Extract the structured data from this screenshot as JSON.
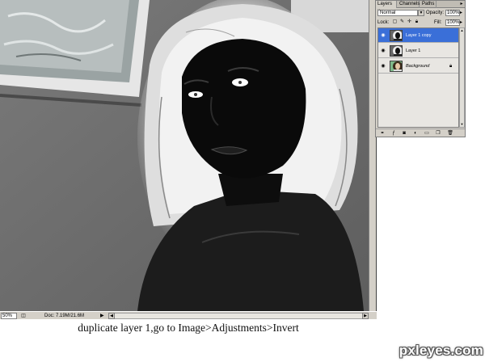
{
  "layers_panel": {
    "tabs": [
      {
        "label": "Layers ×"
      },
      {
        "label": "Channels"
      },
      {
        "label": "Paths"
      }
    ],
    "menu_icon": "panel-menu-arrow-icon",
    "blend_mode": "Normal",
    "opacity_label": "Opacity:",
    "opacity_value": "100%",
    "lock_label": "Lock:",
    "fill_label": "Fill:",
    "fill_value": "100%",
    "layers": [
      {
        "name": "Layer 1 copy",
        "selected": true,
        "thumb": "inverted-portrait"
      },
      {
        "name": "Layer 1",
        "selected": false,
        "thumb": "inverted-portrait"
      },
      {
        "name": "Background",
        "selected": false,
        "thumb": "color-portrait",
        "locked": true
      }
    ],
    "colors": {
      "selection": "#3a6fd8",
      "panel_bg": "#d4d0c8"
    }
  },
  "status_bar": {
    "zoom": "50%",
    "doc_size": "Doc: 7.19M/21.6M"
  },
  "caption": "duplicate layer 1,go to Image>Adjustments>Invert",
  "watermark": "pxleyes.com"
}
